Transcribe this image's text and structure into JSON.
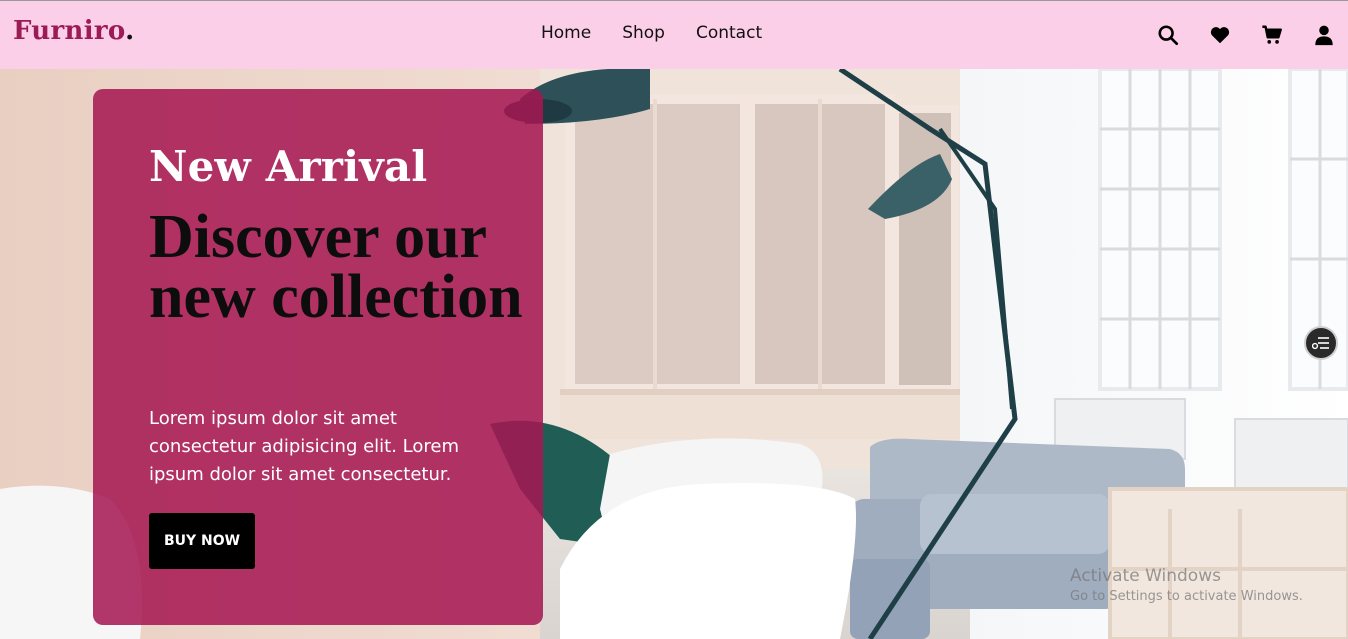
{
  "brand": {
    "name": "Furniro",
    "dot": "."
  },
  "nav": [
    {
      "label": "Home"
    },
    {
      "label": "Shop"
    },
    {
      "label": "Contact"
    }
  ],
  "header_icons": [
    "search-icon",
    "heart-icon",
    "cart-icon",
    "user-icon"
  ],
  "hero": {
    "eyebrow": "New Arrival",
    "headline": "Discover our new collection",
    "description": "Lorem ipsum dolor sit amet consectetur adipisicing elit. Lorem ipsum dolor sit amet consectetur.",
    "cta_label": "BUY NOW"
  },
  "watermark": {
    "title": "Activate Windows",
    "subtitle": "Go to Settings to activate Windows."
  },
  "colors": {
    "header_bg": "#fccfe8",
    "brand": "#9b1b55",
    "card_bg": "#a51652",
    "button_bg": "#000000"
  }
}
